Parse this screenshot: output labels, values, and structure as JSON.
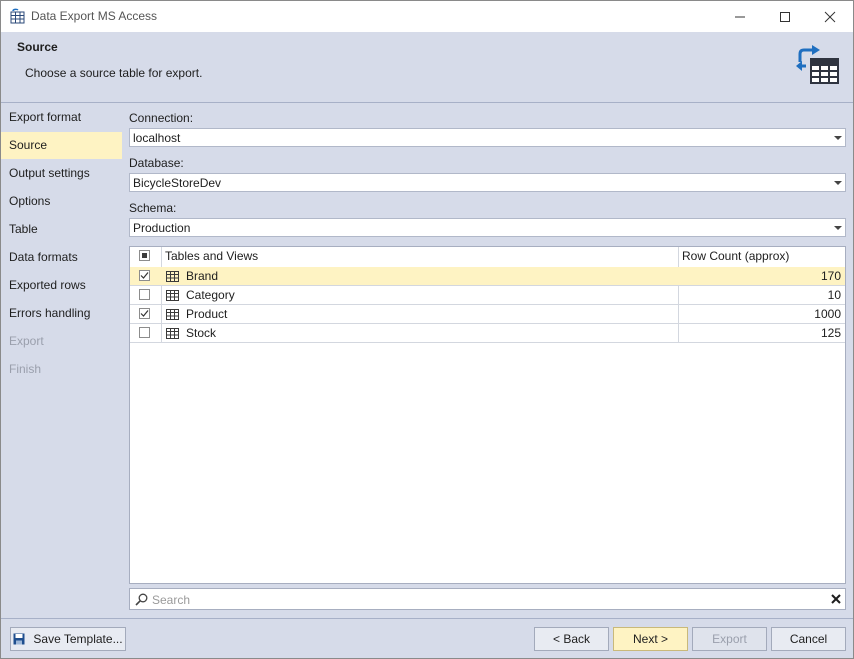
{
  "window": {
    "title": "Data Export MS Access",
    "controls": [
      "minimize",
      "maximize",
      "close"
    ]
  },
  "header": {
    "title": "Source",
    "subtitle": "Choose a source table for export."
  },
  "sidebar": {
    "items": [
      {
        "label": "Export format",
        "state": "normal"
      },
      {
        "label": "Source",
        "state": "active"
      },
      {
        "label": "Output settings",
        "state": "normal"
      },
      {
        "label": "Options",
        "state": "normal"
      },
      {
        "label": "Table",
        "state": "normal"
      },
      {
        "label": "Data formats",
        "state": "normal"
      },
      {
        "label": "Exported rows",
        "state": "normal"
      },
      {
        "label": "Errors handling",
        "state": "normal"
      },
      {
        "label": "Export",
        "state": "disabled"
      },
      {
        "label": "Finish",
        "state": "disabled"
      }
    ]
  },
  "form": {
    "connection_label": "Connection:",
    "connection_value": "localhost",
    "database_label": "Database:",
    "database_value": "BicycleStoreDev",
    "schema_label": "Schema:",
    "schema_value": "Production"
  },
  "grid": {
    "headers": {
      "name": "Tables and Views",
      "count": "Row Count (approx)"
    },
    "header_checkbox": "indeterminate",
    "rows": [
      {
        "checked": true,
        "name": "Brand",
        "count": "170",
        "selected": true
      },
      {
        "checked": false,
        "name": "Category",
        "count": "10",
        "selected": false
      },
      {
        "checked": true,
        "name": "Product",
        "count": "1000",
        "selected": false
      },
      {
        "checked": false,
        "name": "Stock",
        "count": "125",
        "selected": false
      }
    ]
  },
  "search": {
    "placeholder": "Search"
  },
  "footer": {
    "save_template": "Save Template...",
    "back": "< Back",
    "next": "Next >",
    "export": "Export",
    "cancel": "Cancel"
  },
  "icons": {
    "app": "table-export-icon",
    "header": "export-table-icon",
    "row": "table-icon",
    "search": "search-icon",
    "clear": "clear-icon",
    "save": "save-icon"
  },
  "colors": {
    "selection": "#fef3c3",
    "panel": "#d6dbe9",
    "accent_blue": "#1f6fc0"
  }
}
